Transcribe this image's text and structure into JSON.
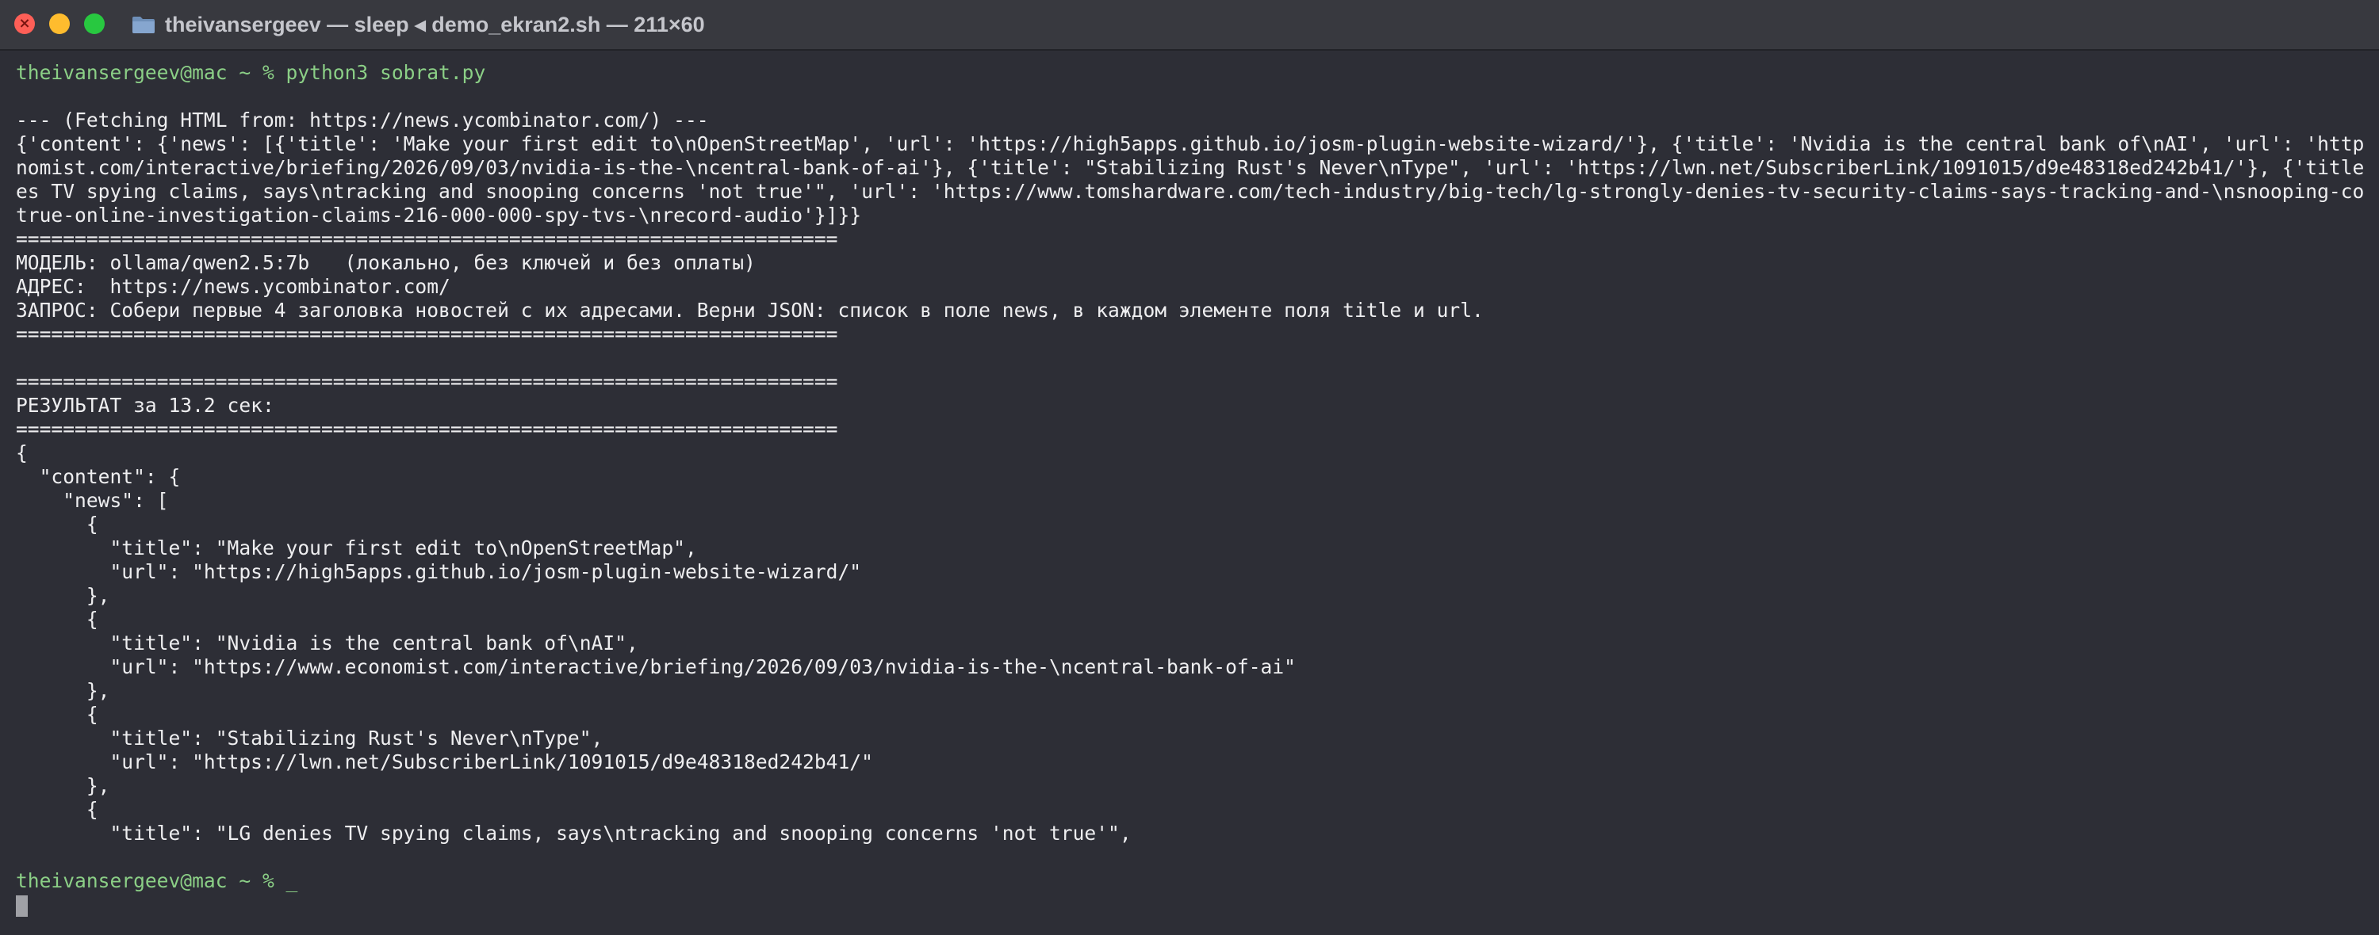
{
  "window": {
    "title": "theivansergeev — sleep ◂ demo_ekran2.sh — 211×60"
  },
  "terminal": {
    "lines": [
      "theivansergeev@mac ~ % python3 sobrat.py",
      "",
      "--- (Fetching HTML from: https://news.ycombinator.com/) ---",
      "{'content': {'news': [{'title': 'Make your first edit to\\nOpenStreetMap', 'url': 'https://high5apps.github.io/josm-plugin-website-wizard/'}, {'title': 'Nvidia is the central bank of\\nAI', 'url': 'https://www.eco",
      "nomist.com/interactive/briefing/2026/09/03/nvidia-is-the-\\ncentral-bank-of-ai'}, {'title': \"Stabilizing Rust's Never\\nType\", 'url': 'https://lwn.net/SubscriberLink/1091015/d9e48318ed242b41/'}, {'title': \"LG deni",
      "es TV spying claims, says\\ntracking and snooping concerns 'not true'\", 'url': 'https://www.tomshardware.com/tech-industry/big-tech/lg-strongly-denies-tv-security-claims-says-tracking-and-\\nsnooping-concerns-not-",
      "true-online-investigation-claims-216-000-000-spy-tvs-\\nrecord-audio'}]}}",
      "======================================================================",
      "МОДЕЛЬ: ollama/qwen2.5:7b   (локально, без ключей и без оплаты)",
      "АДРЕС:  https://news.ycombinator.com/",
      "ЗАПРОС: Собери первые 4 заголовка новостей с их адресами. Верни JSON: список в поле news, в каждом элементе поля title и url.",
      "======================================================================",
      "",
      "======================================================================",
      "РЕЗУЛЬТАТ за 13.2 сек:",
      "======================================================================",
      "{",
      "  \"content\": {",
      "    \"news\": [",
      "      {",
      "        \"title\": \"Make your first edit to\\nOpenStreetMap\",",
      "        \"url\": \"https://high5apps.github.io/josm-plugin-website-wizard/\"",
      "      },",
      "      {",
      "        \"title\": \"Nvidia is the central bank of\\nAI\",",
      "        \"url\": \"https://www.economist.com/interactive/briefing/2026/09/03/nvidia-is-the-\\ncentral-bank-of-ai\"",
      "      },",
      "      {",
      "        \"title\": \"Stabilizing Rust's Never\\nType\",",
      "        \"url\": \"https://lwn.net/SubscriberLink/1091015/d9e48318ed242b41/\"",
      "      },",
      "      {",
      "        \"title\": \"LG denies TV spying claims, says\\ntracking and snooping concerns 'not true'\",",
      ""
    ],
    "final_prompt": "theivansergeev@mac ~ % _"
  },
  "colors": {
    "background": "#2d2e36",
    "titlebar": "#38393f",
    "text": "#eeeef0",
    "prompt": "#8bcf86",
    "cursor": "#a0a1a6",
    "close_light": "#fe5f57",
    "minimize_light": "#febc2e",
    "zoom_light": "#28c840"
  },
  "icons": {
    "close": "close-icon",
    "minimize": "minimize-icon",
    "zoom": "zoom-icon",
    "folder": "folder-icon"
  }
}
